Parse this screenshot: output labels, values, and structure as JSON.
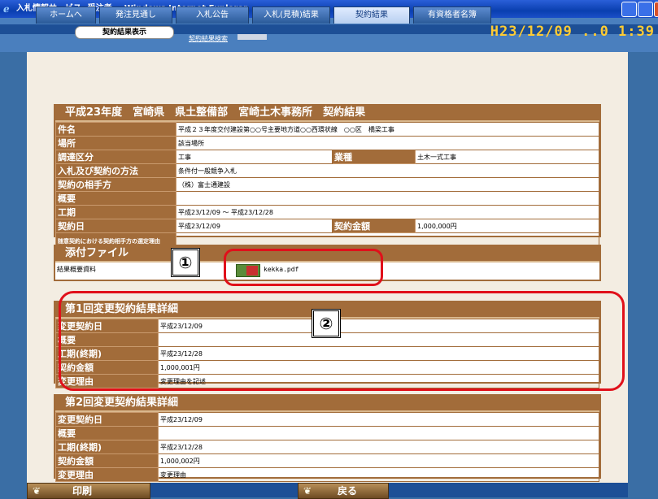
{
  "window": {
    "title": "入札情報サービス -受注者- - Windows Internet Explorer"
  },
  "nav": {
    "tabs": [
      "ホームへ",
      "発注見通し",
      "入札公告",
      "入札(見積)結果",
      "契約結果",
      "有資格者名簿"
    ],
    "active_tab": "契約結果",
    "sub_pill": "契約結果表示",
    "search_link": "契約結果検索",
    "clock": "H23/12/09 ..0 1:39"
  },
  "contract": {
    "header": "平成23年度　宮崎県　県土整備部　宮崎土木事務所　契約結果",
    "rows": [
      {
        "label": "件名",
        "value": "平成２３年度交付建設第○○号主要地方道○○西環状線　○○区　橋梁工事"
      },
      {
        "label": "場所",
        "value": "該当場所"
      },
      {
        "label": "調達区分",
        "value": "工事",
        "label2": "業種",
        "value2": "土木一式工事"
      },
      {
        "label": "入札及び契約の方法",
        "value": "条件付一般競争入札"
      },
      {
        "label": "契約の相手方",
        "value": "（株）富士通建設"
      },
      {
        "label": "概要",
        "value": ""
      },
      {
        "label": "工期",
        "value": "平成23/12/09 ～ 平成23/12/28"
      },
      {
        "label": "契約日",
        "value": "平成23/12/09",
        "label2": "契約金額",
        "value2": "1,000,000円"
      },
      {
        "label": "随意契約における契約相手方の選定理由",
        "value": ""
      }
    ]
  },
  "attachment": {
    "header": "添付ファイル",
    "label": "結果概要資料",
    "file": "kekka.pdf",
    "icon_text": "Down load"
  },
  "change1": {
    "header": "第1回変更契約結果詳細",
    "rows": [
      {
        "label": "変更契約日",
        "value": "平成23/12/09"
      },
      {
        "label": "概要",
        "value": ""
      },
      {
        "label": "工期(終期)",
        "value": "平成23/12/28"
      },
      {
        "label": "契約金額",
        "value": "1,000,001円"
      },
      {
        "label": "変更理由",
        "value": "変更理由を記述"
      }
    ]
  },
  "change2": {
    "header": "第2回変更契約結果詳細",
    "rows": [
      {
        "label": "変更契約日",
        "value": "平成23/12/09"
      },
      {
        "label": "概要",
        "value": ""
      },
      {
        "label": "工期(終期)",
        "value": "平成23/12/28"
      },
      {
        "label": "契約金額",
        "value": "1,000,002円"
      },
      {
        "label": "変更理由",
        "value": "変更理由"
      }
    ]
  },
  "callouts": {
    "one": "①",
    "two": "②"
  },
  "buttons": {
    "print": "印刷",
    "back": "戻る"
  },
  "colors": {
    "accent": "#a26c3a",
    "highlight": "#e0101a",
    "clock": "#ffcc33"
  }
}
